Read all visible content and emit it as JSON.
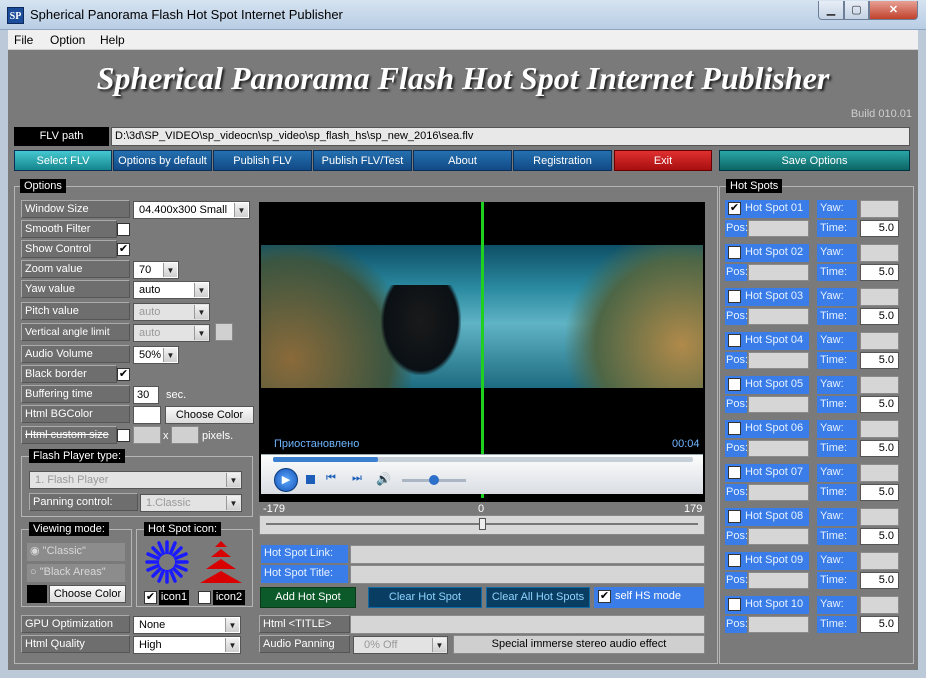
{
  "window": {
    "title": "Spherical Panorama Flash Hot Spot Internet Publisher",
    "icon_text": "SP"
  },
  "menu": [
    "File",
    "Option",
    "Help"
  ],
  "banner": {
    "title": "Spherical Panorama Flash Hot Spot Internet Publisher",
    "build": "Build 010.01"
  },
  "flv": {
    "label": "FLV path",
    "path": "D:\\3d\\SP_VIDEO\\sp_videocn\\sp_video\\sp_flash_hs\\sp_new_2016\\sea.flv"
  },
  "toolbar": {
    "select_flv": "Select FLV",
    "options_default": "Options by default",
    "publish_flv": "Publish FLV",
    "publish_test": "Publish FLV/Test",
    "about": "About",
    "registration": "Registration",
    "exit": "Exit",
    "save_options": "Save Options"
  },
  "options": {
    "title": "Options",
    "window_size": {
      "label": "Window Size",
      "value": "04.400x300 Small"
    },
    "smooth_filter": {
      "label": "Smooth Filter",
      "checked": false
    },
    "show_control": {
      "label": "Show Control",
      "checked": true
    },
    "zoom": {
      "label": "Zoom value",
      "value": "70"
    },
    "yaw": {
      "label": "Yaw value",
      "value": "auto"
    },
    "pitch": {
      "label": "Pitch value",
      "value": "auto"
    },
    "vertical": {
      "label": "Vertical angle limit",
      "value": "auto"
    },
    "audio_volume": {
      "label": "Audio Volume",
      "value": "50%"
    },
    "black_border": {
      "label": "Black border",
      "checked": true
    },
    "buffering": {
      "label": "Buffering time",
      "value": "30",
      "unit": "sec."
    },
    "html_bgcolor": {
      "label": "Html BGColor",
      "button": "Choose Color"
    },
    "html_custom_size": {
      "label": "Html custom size",
      "x": "x",
      "unit": "pixels."
    }
  },
  "flash_player": {
    "title": "Flash Player type:",
    "value": "1. Flash Player",
    "panning_label": "Panning control:",
    "panning_value": "1.Classic"
  },
  "viewing_mode": {
    "title": "Viewing mode:",
    "classic": "\"Classic\"",
    "black_areas": "\"Black Areas\"",
    "button": "Choose Color"
  },
  "hs_icon": {
    "title": "Hot Spot icon:",
    "icon1": "icon1",
    "icon2": "icon2"
  },
  "gpu": {
    "label": "GPU Optimization",
    "value": "None"
  },
  "html_quality": {
    "label": "Html Quality",
    "value": "High"
  },
  "player": {
    "status": "Приостановлено",
    "time": "00:04",
    "range_min": "-179",
    "range_mid": "0",
    "range_max": "179",
    "volume": 0.5,
    "progress": 0.25
  },
  "hotspot_fields": {
    "link": "Hot Spot Link:",
    "title": "Hot Spot Title:"
  },
  "hs_actions": {
    "add": "Add Hot Spot",
    "clear": "Clear Hot Spot",
    "clear_all": "Clear All Hot Spots",
    "self_hs": "self HS mode"
  },
  "html_title": {
    "label": "Html <TITLE>"
  },
  "audio_panning": {
    "label": "Audio Panning",
    "value": "0% Off",
    "note": "Special immerse stereo audio effect"
  },
  "hotspots_panel": {
    "title": "Hot Spots",
    "yaw_label": "Yaw:",
    "pos_label": "Pos:",
    "time_label": "Time:",
    "items": [
      {
        "name": "Hot Spot 01",
        "time": "5.0",
        "checked": true
      },
      {
        "name": "Hot Spot 02",
        "time": "5.0",
        "checked": false
      },
      {
        "name": "Hot Spot 03",
        "time": "5.0",
        "checked": false
      },
      {
        "name": "Hot Spot 04",
        "time": "5.0",
        "checked": false
      },
      {
        "name": "Hot Spot 05",
        "time": "5.0",
        "checked": false
      },
      {
        "name": "Hot Spot 06",
        "time": "5.0",
        "checked": false
      },
      {
        "name": "Hot Spot 07",
        "time": "5.0",
        "checked": false
      },
      {
        "name": "Hot Spot 08",
        "time": "5.0",
        "checked": false
      },
      {
        "name": "Hot Spot 09",
        "time": "5.0",
        "checked": false
      },
      {
        "name": "Hot Spot 10",
        "time": "5.0",
        "checked": false
      }
    ]
  }
}
